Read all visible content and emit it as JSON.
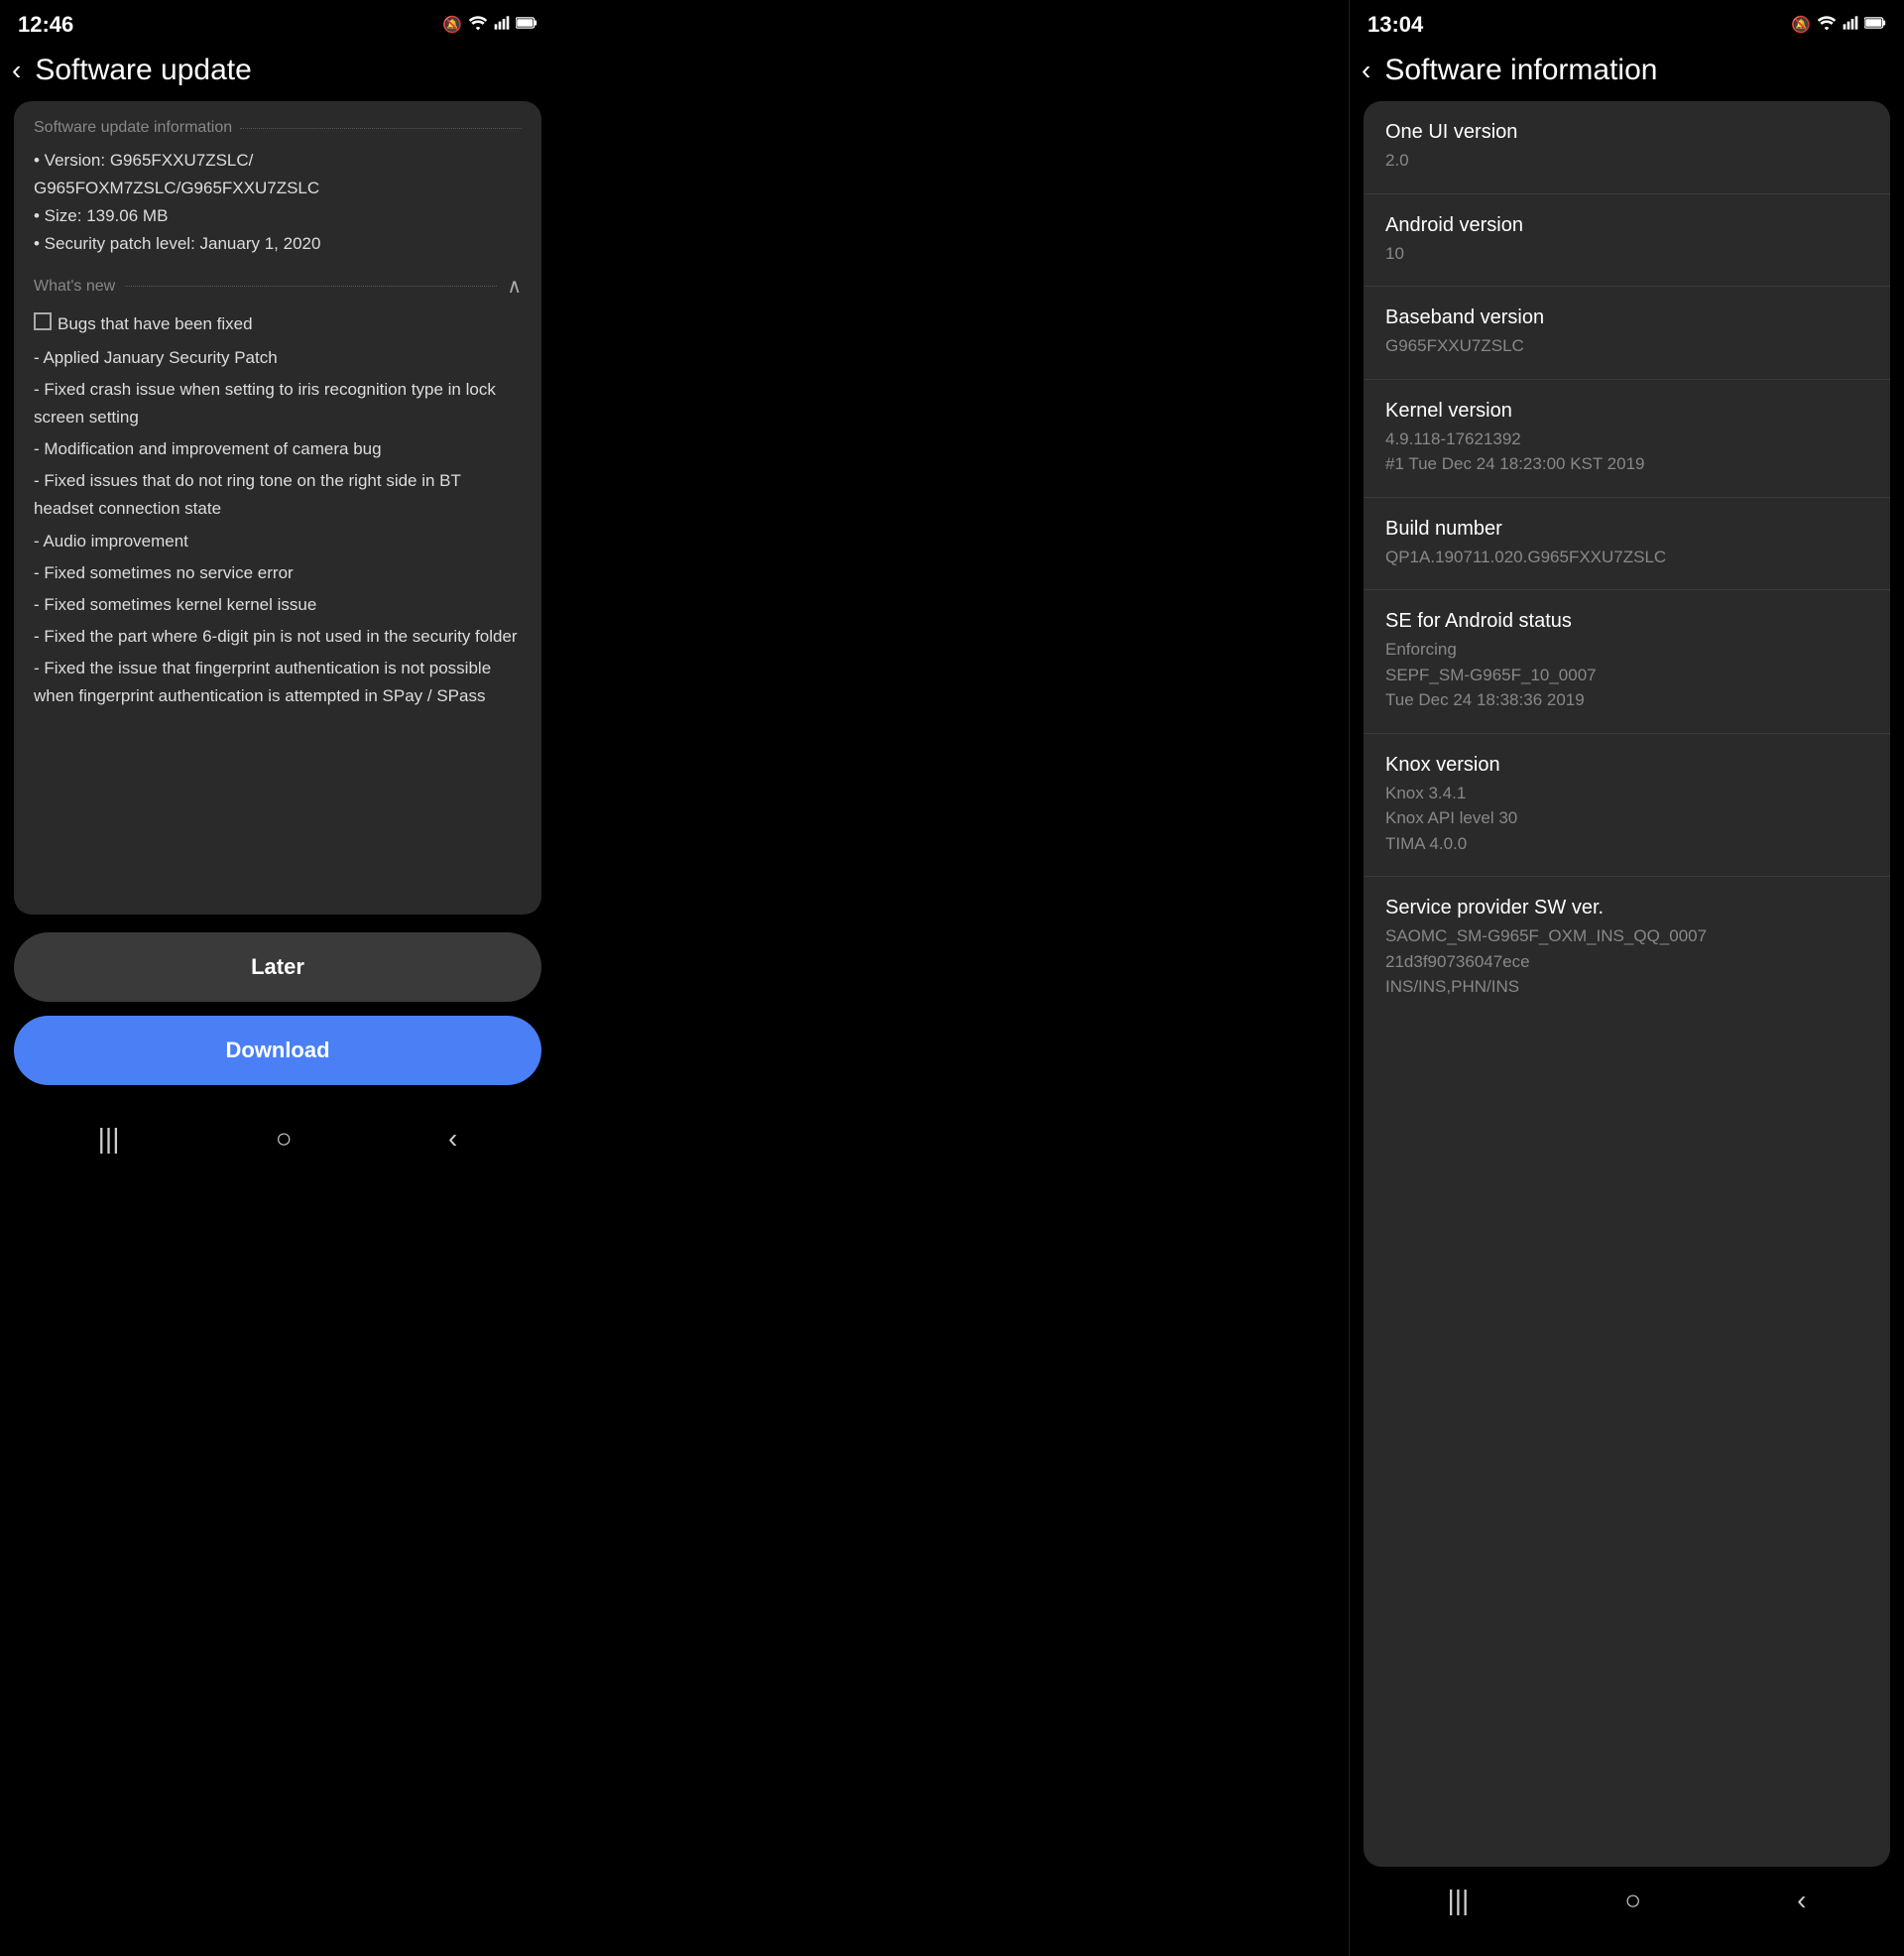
{
  "left": {
    "status_bar": {
      "time": "12:46",
      "icons": "🔕 📶 📶 🔋"
    },
    "header": {
      "back_label": "‹",
      "title": "Software update"
    },
    "update_info_section": {
      "label": "Software update information",
      "version_line": "• Version: G965FXXU7ZSLC/",
      "version_line2": "  G965FOXM7ZSLC/G965FXXU7ZSLC",
      "size_line": "• Size: 139.06 MB",
      "security_line": "• Security patch level: January 1, 2020"
    },
    "whats_new": {
      "label": "What's new",
      "items": [
        "Bugs that have been fixed",
        "- Applied January Security Patch",
        "- Fixed crash issue when setting to iris recognition type in lock screen setting",
        "- Modification and improvement of camera bug",
        "- Fixed issues that do not ring tone on the right side in BT headset connection state",
        "- Audio improvement",
        "- Fixed sometimes no service error",
        "- Fixed sometimes kernel kernel issue",
        "- Fixed the part where 6-digit pin is not used in the security folder",
        "- Fixed the issue that fingerprint authentication is not possible when fingerprint authentication is attempted in SPay / SPass"
      ]
    },
    "buttons": {
      "later": "Later",
      "download": "Download"
    },
    "nav_bar": {
      "recents": "|||",
      "home": "○",
      "back": "‹"
    }
  },
  "right": {
    "status_bar": {
      "time": "13:04",
      "icons": "🔕 📶 📶 🔋"
    },
    "header": {
      "back_label": "‹",
      "title": "Software information"
    },
    "info_items": [
      {
        "label": "One UI version",
        "value": "2.0"
      },
      {
        "label": "Android version",
        "value": "10"
      },
      {
        "label": "Baseband version",
        "value": "G965FXXU7ZSLC"
      },
      {
        "label": "Kernel version",
        "value": "4.9.118-17621392\n#1 Tue Dec 24 18:23:00 KST 2019"
      },
      {
        "label": "Build number",
        "value": "QP1A.190711.020.G965FXXU7ZSLC"
      },
      {
        "label": "SE for Android status",
        "value": "Enforcing\nSEPF_SM-G965F_10_0007\nTue Dec 24 18:38:36 2019"
      },
      {
        "label": "Knox version",
        "value": "Knox 3.4.1\nKnox API level 30\nTIMA 4.0.0"
      },
      {
        "label": "Service provider SW ver.",
        "value": "SAOMC_SM-G965F_OXM_INS_QQ_0007\n21d3f90736047ece\nINS/INS,PHN/INS"
      }
    ],
    "nav_bar": {
      "recents": "|||",
      "home": "○",
      "back": "‹"
    }
  }
}
